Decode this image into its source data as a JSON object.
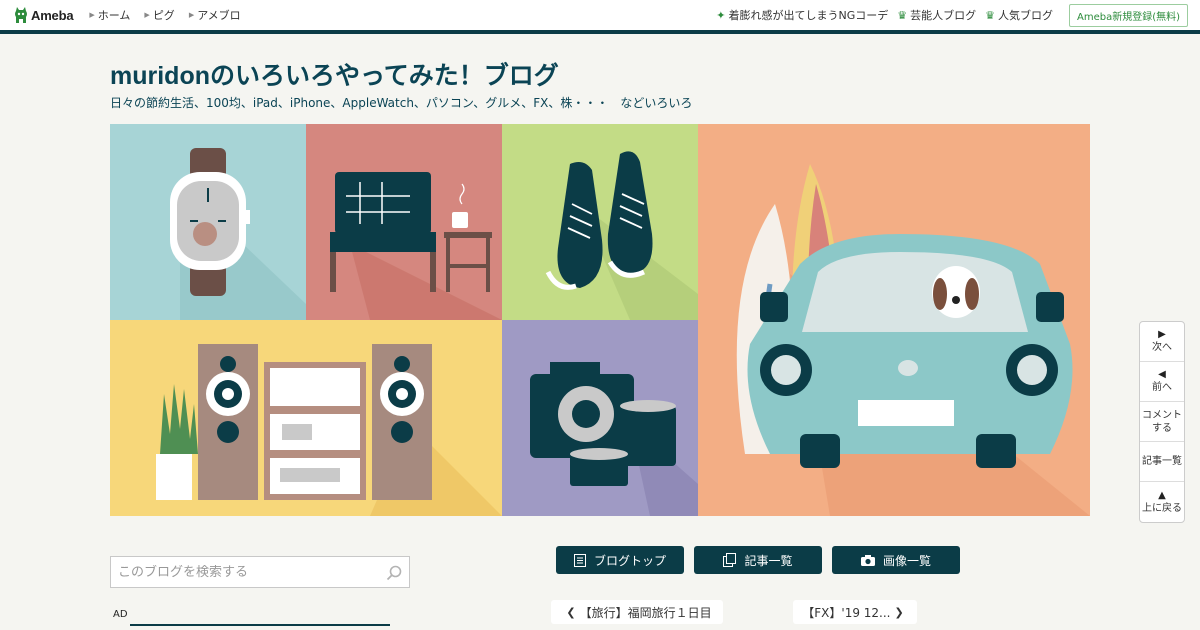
{
  "topnav": {
    "logo_text": "Ameba",
    "left_links": [
      {
        "label": "ホーム"
      },
      {
        "label": "ピグ"
      },
      {
        "label": "アメブロ"
      }
    ],
    "right_links": [
      {
        "label": "着膨れ感が出てしまうNGコーデ",
        "icon": "sparkle-icon"
      },
      {
        "label": "芸能人ブログ",
        "icon": "crown-icon"
      },
      {
        "label": "人気ブログ",
        "icon": "crown-icon"
      }
    ],
    "register_label": "Ameba新規登録(無料)"
  },
  "blog": {
    "title": "muridonのいろいろやってみた！ブログ",
    "description": "日々の節約生活、100均、iPad、iPhone、AppleWatch、パソコン、グルメ、FX、株・・・　などいろいろ"
  },
  "search": {
    "placeholder": "このブログを検索する"
  },
  "ad_label": "AD",
  "blog_buttons": [
    {
      "label": "ブログトップ",
      "icon": "document-icon"
    },
    {
      "label": "記事一覧",
      "icon": "copy-icon"
    },
    {
      "label": "画像一覧",
      "icon": "camera-icon"
    }
  ],
  "article_nav": {
    "prev": "【旅行】福岡旅行１日目",
    "next": "【FX】'19 12..."
  },
  "side_nav": [
    {
      "label": "次へ",
      "arrow": "▶"
    },
    {
      "label": "前へ",
      "arrow": "◀"
    },
    {
      "label": "コメント\nする",
      "arrow": ""
    },
    {
      "label": "記事一覧",
      "arrow": ""
    },
    {
      "label": "上に戻る",
      "arrow": "▲"
    }
  ],
  "colors": {
    "header_dark": "#0b3c47",
    "brand_green": "#2d8c3c",
    "page_bg": "#f5f5f1"
  }
}
